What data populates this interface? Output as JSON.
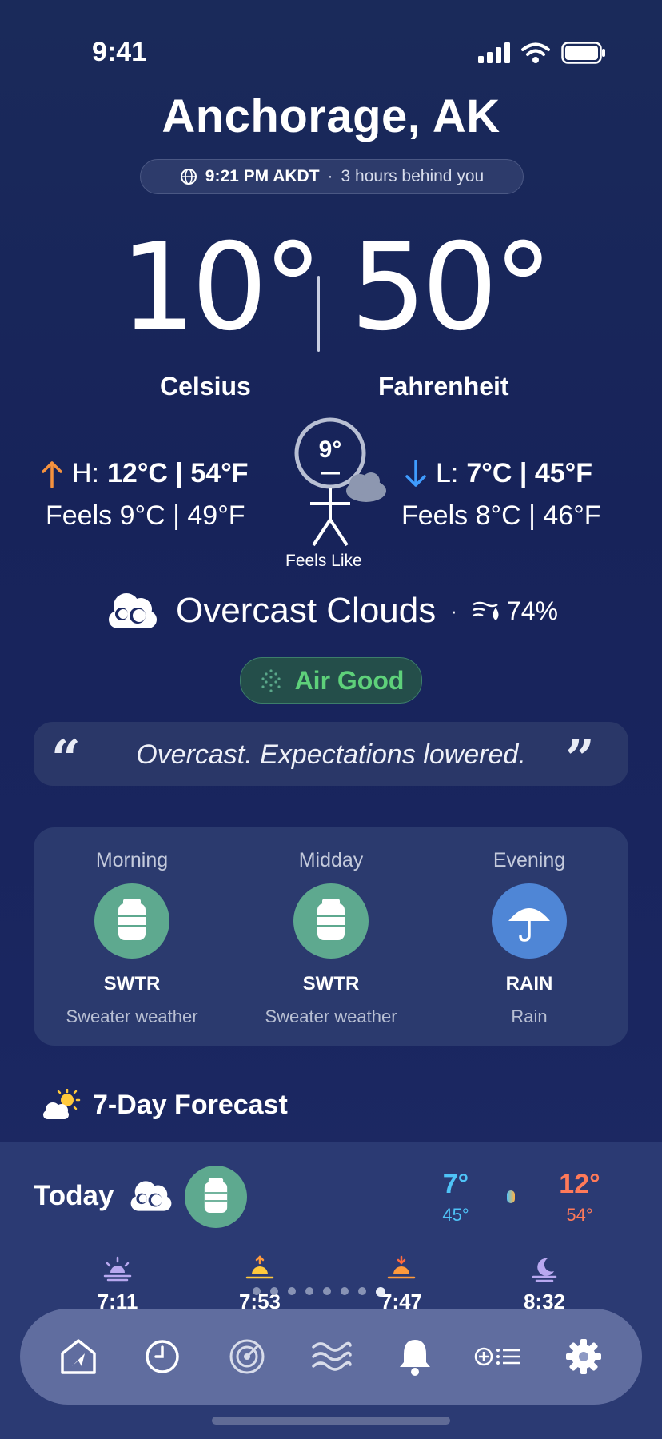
{
  "status_bar": {
    "time": "9:41"
  },
  "location": {
    "city": "Anchorage, AK",
    "local_time": "9:21 PM AKDT",
    "separator": "·",
    "offset": "3 hours behind you"
  },
  "temps": {
    "celsius": "10°",
    "fahrenheit": "50°",
    "celsius_label": "Celsius",
    "fahrenheit_label": "Fahrenheit"
  },
  "high": {
    "prefix": "H:",
    "value": "12°C | 54°F",
    "feels": "Feels 9°C | 49°F"
  },
  "low": {
    "prefix": "L:",
    "value": "7°C | 45°F",
    "feels": "Feels 8°C | 46°F"
  },
  "feels_like": {
    "value": "9°",
    "label": "Feels Like"
  },
  "condition": {
    "text": "Overcast Clouds",
    "separator": "·",
    "humidity": "74%"
  },
  "air": {
    "label": "Air Good"
  },
  "quote": {
    "open": "“",
    "text": "Overcast. Expectations lowered.",
    "close": "”"
  },
  "periods": [
    {
      "name": "Morning",
      "code": "SWTR",
      "desc": "Sweater weather",
      "icon": "sweater-icon",
      "color": "#5ea98f"
    },
    {
      "name": "Midday",
      "code": "SWTR",
      "desc": "Sweater weather",
      "icon": "sweater-icon",
      "color": "#5ea98f"
    },
    {
      "name": "Evening",
      "code": "RAIN",
      "desc": "Rain",
      "icon": "umbrella-icon",
      "color": "#4f86d6"
    }
  ],
  "forecast": {
    "title": "7-Day Forecast",
    "today": {
      "label": "Today",
      "low": "7°",
      "low_f": "45°",
      "high": "12°",
      "high_f": "54°",
      "sun_times": [
        "7:11",
        "7:53",
        "7:47",
        "8:32"
      ]
    }
  },
  "colors": {
    "low": "#4fc3f7",
    "high": "#ff7a59",
    "air": "#5ed17a"
  },
  "tabs": [
    "home-icon",
    "clock-icon",
    "radar-icon",
    "waves-icon",
    "bell-icon",
    "add-list-icon",
    "gear-icon"
  ]
}
